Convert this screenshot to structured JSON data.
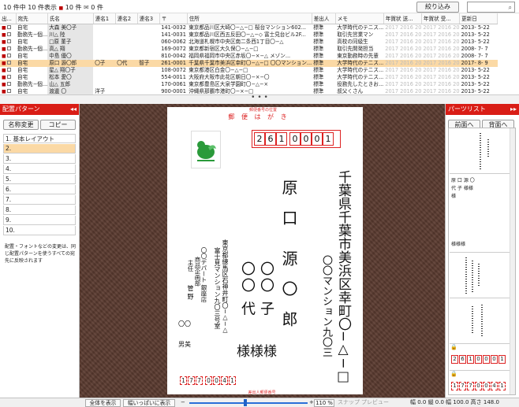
{
  "topbar": {
    "count": "10 件中 10 件表示 ",
    "printer_count": "10 件",
    "mail_count": "0 件",
    "narrow_button": "絞り込み",
    "search_placeholder": ""
  },
  "table": {
    "columns": [
      "出...",
      "宛先",
      "氏名",
      "連名1",
      "連名2",
      "連名3",
      "〒",
      "住所",
      "差出人",
      "メモ",
      "年賀状 送...",
      "年賀状 受...",
      "更新日"
    ],
    "rows": [
      {
        "dest": "自宅",
        "name": "大森 美〇子",
        "rn1": "",
        "rn2": "",
        "rn3": "",
        "zip": "141-0032",
        "addr": "東京都品川区大崎〇−△−□ 桜台マンション602...",
        "sender": "標準",
        "memo": "大学時代のテニス...",
        "sent": "2017 2016 20",
        "recv": "2017 2016 20",
        "date": "2013- 5-22"
      },
      {
        "dest": "勤務先−個...",
        "name": "川△ 陸",
        "rn1": "",
        "rn2": "",
        "rn3": "",
        "zip": "141-0031",
        "addr": "東京都品川区西五反田〇−△−◇ 富士見台ビル2F...",
        "sender": "標準",
        "memo": "取引先営業マン",
        "sent": "2017 2016 20",
        "recv": "2017 2016 20",
        "date": "2013- 5-22"
      },
      {
        "dest": "自宅",
        "name": "□原 菫子",
        "rn1": "",
        "rn2": "",
        "rn3": "",
        "zip": "060-0062",
        "addr": "北海道札幌市中央区南二条西1丁目〇−△",
        "sender": "標準",
        "memo": "高校の同級生",
        "sent": "2017 2016 20",
        "recv": "2017 2016 20",
        "date": "2013- 5-22"
      },
      {
        "dest": "勤務先−個...",
        "name": "高△ 翔",
        "rn1": "",
        "rn2": "",
        "rn3": "",
        "zip": "169-0072",
        "addr": "東京都新宿区大久保〇−△−□",
        "sender": "標準",
        "memo": "取引先開発担当",
        "sent": "2017 2016 20",
        "recv": "2017 2016 20",
        "date": "2008- 7- 7"
      },
      {
        "dest": "自宅",
        "name": "中島 優〇",
        "rn1": "",
        "rn2": "",
        "rn3": "",
        "zip": "810-0042",
        "addr": "福岡県福岡市中央区赤坂〇−×−△ メゾン...",
        "sender": "標準",
        "memo": "東京勤務時の先輩",
        "sent": "2017 2016 20",
        "recv": "2017 2016 20",
        "date": "2008- 7- 7"
      },
      {
        "dest": "自宅",
        "name": "原口 源〇郎",
        "rn1": "〇子",
        "rn2": "〇代",
        "rn3": "智子",
        "zip": "261-0001",
        "addr": "千葉県千葉市美浜区幸町〇−△−□ 〇〇マンション...",
        "sender": "標準",
        "memo": "大学時代のテニス...",
        "sent": "2017 2016 20",
        "recv": "2017 2016 20",
        "date": "2017- 8- 9"
      },
      {
        "dest": "自宅",
        "name": "星△ 翔〇子",
        "rn1": "",
        "rn2": "",
        "rn3": "",
        "zip": "108-0072",
        "addr": "東京都港区白金〇−△−□",
        "sender": "標準",
        "memo": "大学時代のテニス...",
        "sent": "2017 2016 20",
        "recv": "2017 2016 20",
        "date": "2013- 5-22"
      },
      {
        "dest": "自宅",
        "name": "松本 愛〇",
        "rn1": "",
        "rn2": "",
        "rn3": "",
        "zip": "554-0011",
        "addr": "大阪府大阪市此花区朝日〇−×−〇",
        "sender": "標準",
        "memo": "大学時代のテニス...",
        "sent": "2017 2016 20",
        "recv": "2017 2016 20",
        "date": "2013- 5-22"
      },
      {
        "dest": "勤務先−個...",
        "name": "山△ 五郎",
        "rn1": "",
        "rn2": "",
        "rn3": "",
        "zip": "170-0061",
        "addr": "東京都豊島区大泉学園町〇−△−×",
        "sender": "標準",
        "memo": "役務先したときお...",
        "sent": "2017 2016 20",
        "recv": "2017 2016 20",
        "date": "2013- 5-22"
      },
      {
        "dest": "自宅",
        "name": "渡邊 〇",
        "rn1": "洋子",
        "rn2": "",
        "rn3": "",
        "zip": "900-0001",
        "addr": "沖縄県那覇市港町〇−×−□",
        "sender": "標準",
        "memo": "叔父くさん",
        "sent": "2017 2016 20",
        "recv": "2017 2016 20",
        "date": "2013- 5-22"
      }
    ]
  },
  "left": {
    "header": "配置パターン",
    "rename_button": "名称変更",
    "copy_button": "コピー",
    "items": [
      "1. 基本レイアウト",
      "2.",
      "3.",
      "4.",
      "5.",
      "6.",
      "7.",
      "8.",
      "9.",
      "10."
    ],
    "note": "配置・フォントなどの変更は、同じ配置パターンを使うすべての宛先に反映されます"
  },
  "card": {
    "top_label": "郵便番号の位置",
    "hagaki": "郵 便 は が き",
    "zip_digits": [
      "2",
      "6",
      "1",
      "0",
      "0",
      "0",
      "1"
    ],
    "address1": "千葉県千葉市美浜区幸町〇−△−□",
    "address2": "〇〇マンション九〇三",
    "name_family": "原 口",
    "name_main": "源 〇 郎",
    "name_sub1": "〇〇 子",
    "name_sub2": "〇〇 代",
    "honorifics": "様様様",
    "sender_addr1": "東京都練馬区石神井町〇−△−△",
    "sender_addr2": "富士見マンション九〇三号室",
    "sender_company": "〇〇デパート 銀座店",
    "sender_dept": "商品企画部",
    "sender_title": "主任",
    "sender_name": "管 野",
    "sender_extra": "〇〇",
    "sender_first": "男美",
    "sender_zip": [
      "1",
      "7",
      "7",
      "0",
      "0",
      "4",
      "1"
    ],
    "bottom_label": "差出人郵便番号"
  },
  "right": {
    "header": "パーツリスト",
    "front_button": "前面へ",
    "back_button": "背面へ",
    "preview_zip": [
      "2",
      "6",
      "1",
      "0",
      "0",
      "0",
      "1"
    ],
    "preview_sender_zip": [
      "1",
      "7",
      "7",
      "0",
      "0",
      "4",
      "1"
    ],
    "preview_names": "原 口 源 〇 代 子 様様様"
  },
  "status": {
    "show_all": "全体を表示",
    "fit_width": "幅いっぱいに表示",
    "minus": "−",
    "plus": "+",
    "zoom": "110 %",
    "snap": "スナップ",
    "preview": "プレビュー",
    "size": "幅 0.0  縦 0.0  幅 100.0  高さ 148.0"
  },
  "colors": {
    "accent": "#d91d16",
    "selection": "#fbd9a5",
    "wood": "#5b3b30"
  }
}
